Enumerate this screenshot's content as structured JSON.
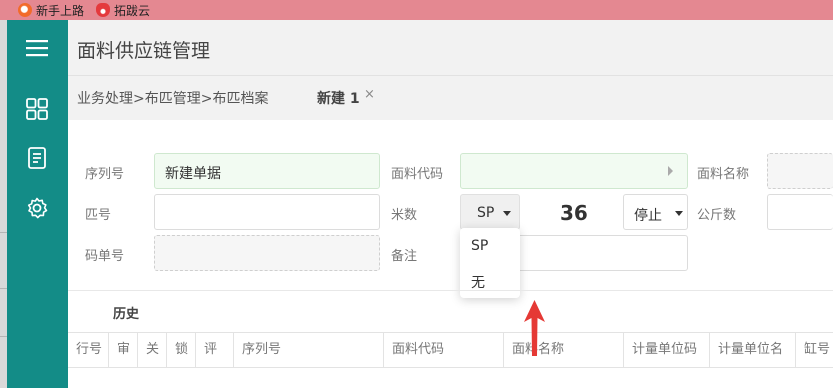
{
  "bookmarks": [
    {
      "label": "新手上路",
      "icon": "firefox-icon"
    },
    {
      "label": "拓跋云",
      "icon": "tuobayun-icon"
    }
  ],
  "sidebar": {
    "items": [
      {
        "icon": "hamburger-menu-icon"
      },
      {
        "icon": "grid-icon"
      },
      {
        "icon": "document-icon"
      },
      {
        "icon": "gear-icon"
      }
    ],
    "color": "#138c87"
  },
  "header": {
    "title": "面料供应链管理"
  },
  "breadcrumb": {
    "path": "业务处理>布匹管理>布匹档案",
    "active_tab": "新建 1",
    "close": "×"
  },
  "form": {
    "serial_label": "序列号",
    "serial_value": "新建单据",
    "fabric_code_label": "面料代码",
    "fabric_code_value": "",
    "fabric_name_label": "面料名称",
    "fabric_name_value": "",
    "bolt_label": "匹号",
    "bolt_value": "",
    "meters_label": "米数",
    "meters_unit_value": "SP",
    "meters_value": "36",
    "status_value": "停止",
    "kg_label": "公斤数",
    "kg_value": "",
    "code_no_label": "码单号",
    "code_no_value": "",
    "remark_label": "备注",
    "remark_value": ""
  },
  "dropdown": {
    "options": [
      "SP",
      "无"
    ]
  },
  "history": {
    "label": "历史"
  },
  "table": {
    "columns": [
      "行号",
      "审",
      "关",
      "锁",
      "评",
      "序列号",
      "面料代码",
      "面料名称",
      "计量单位码",
      "计量单位名",
      "缸号"
    ]
  },
  "colors": {
    "accent": "#138c87",
    "bookmark_bar": "#e48891",
    "annotation_arrow": "#e53935"
  }
}
